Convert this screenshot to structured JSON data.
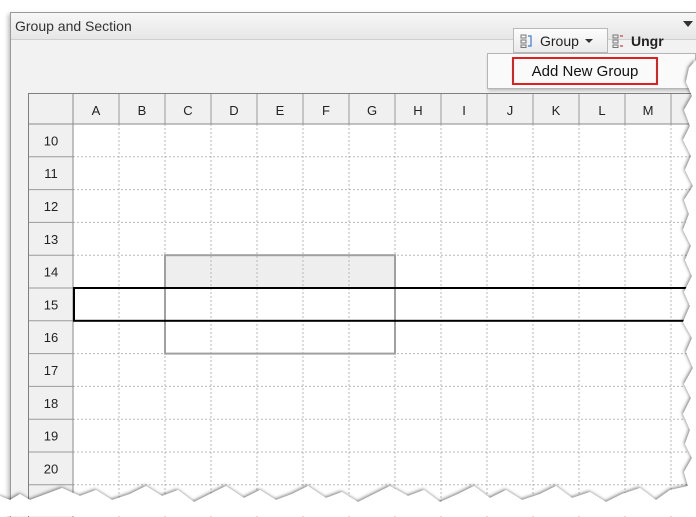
{
  "panel": {
    "title": "Group and Section"
  },
  "toolbar": {
    "group_label": "Group",
    "ungroup_label": "Ungr"
  },
  "dropdown": {
    "items": [
      "Add New Group"
    ]
  },
  "grid": {
    "columns": [
      "A",
      "B",
      "C",
      "D",
      "E",
      "F",
      "G",
      "H",
      "I",
      "J",
      "K",
      "L",
      "M"
    ],
    "rows": [
      "10",
      "11",
      "12",
      "13",
      "14",
      "15",
      "16",
      "17",
      "18",
      "19",
      "20"
    ]
  },
  "colors": {
    "accent_red": "#e0201e",
    "header_bg": "#f0f0f0",
    "section_fill": "#eeeeee"
  }
}
